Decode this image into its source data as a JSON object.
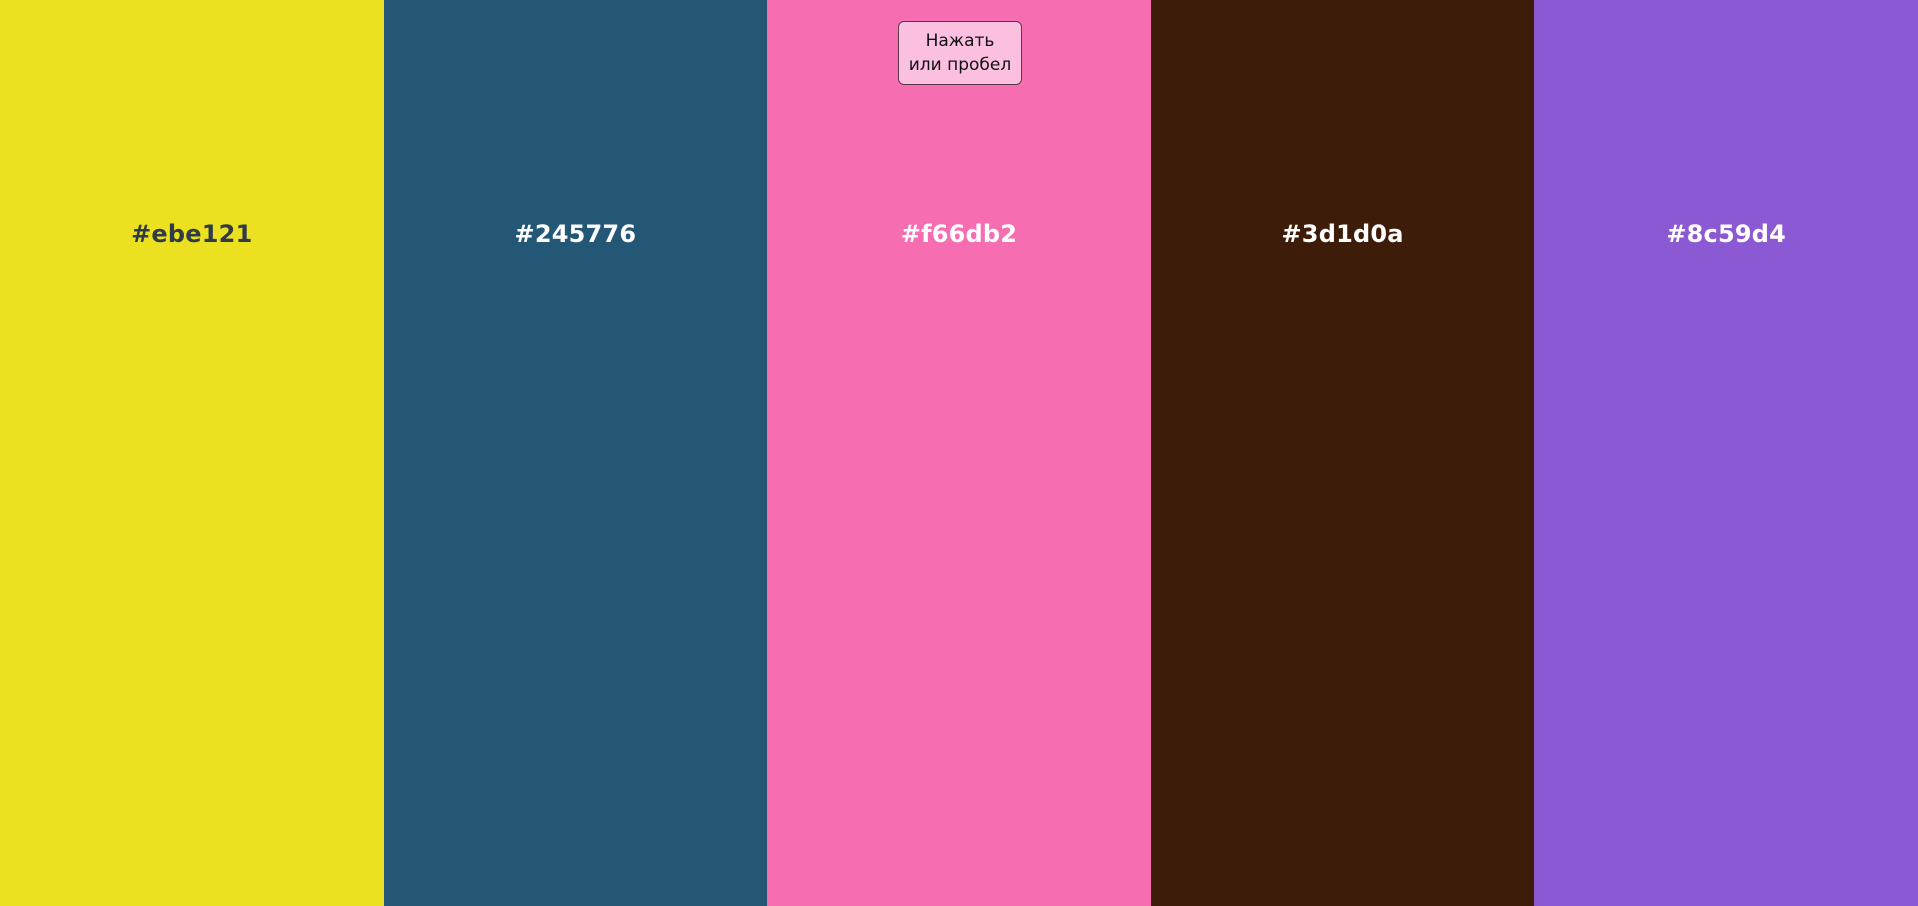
{
  "button": {
    "line1": "Нажать",
    "line2": "или пробел"
  },
  "colors": [
    {
      "hex": "#ebe121",
      "label": "#ebe121",
      "text_color": "#2f3b45"
    },
    {
      "hex": "#245776",
      "label": "#245776",
      "text_color": "#ffffff"
    },
    {
      "hex": "#f66db2",
      "label": "#f66db2",
      "text_color": "#ffffff"
    },
    {
      "hex": "#3d1d0a",
      "label": "#3d1d0a",
      "text_color": "#ffffff"
    },
    {
      "hex": "#8c59d4",
      "label": "#8c59d4",
      "text_color": "#ffffff"
    }
  ]
}
